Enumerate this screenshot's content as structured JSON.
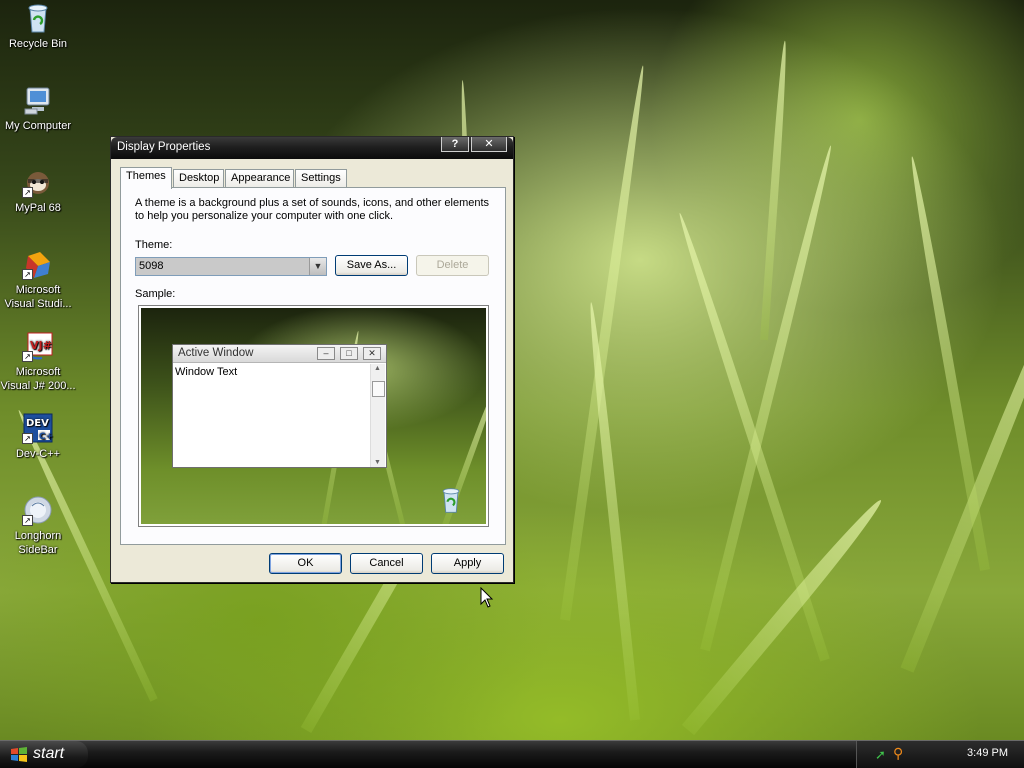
{
  "desktop": {
    "icons": [
      {
        "label": "Recycle Bin",
        "icon": "recycle-bin-icon"
      },
      {
        "label": "My Computer",
        "icon": "my-computer-icon"
      },
      {
        "label": "MyPal 68",
        "icon": "mypal-icon"
      },
      {
        "label": "Microsoft Visual Studi...",
        "icon": "visual-studio-icon"
      },
      {
        "label": "Microsoft Visual J# 200...",
        "icon": "visual-jsharp-icon"
      },
      {
        "label": "Dev-C++",
        "icon": "devcpp-icon"
      },
      {
        "label": "Longhorn SideBar",
        "icon": "longhorn-sidebar-icon"
      }
    ]
  },
  "dialog": {
    "title": "Display Properties",
    "help_glyph": "?",
    "close_glyph": "✕",
    "tabs": [
      {
        "label": "Themes",
        "active": true
      },
      {
        "label": "Desktop",
        "active": false
      },
      {
        "label": "Appearance",
        "active": false
      },
      {
        "label": "Settings",
        "active": false
      }
    ],
    "description": "A theme is a background plus a set of sounds, icons, and other elements to help you personalize your computer with one click.",
    "theme_label": "Theme:",
    "theme_value": "5098",
    "save_as_label": "Save As...",
    "delete_label": "Delete",
    "sample_label": "Sample:",
    "sample": {
      "window_title": "Active Window",
      "window_text": "Window Text"
    },
    "ok_label": "OK",
    "cancel_label": "Cancel",
    "apply_label": "Apply"
  },
  "taskbar": {
    "start_label": "start",
    "clock": "3:49 PM"
  }
}
